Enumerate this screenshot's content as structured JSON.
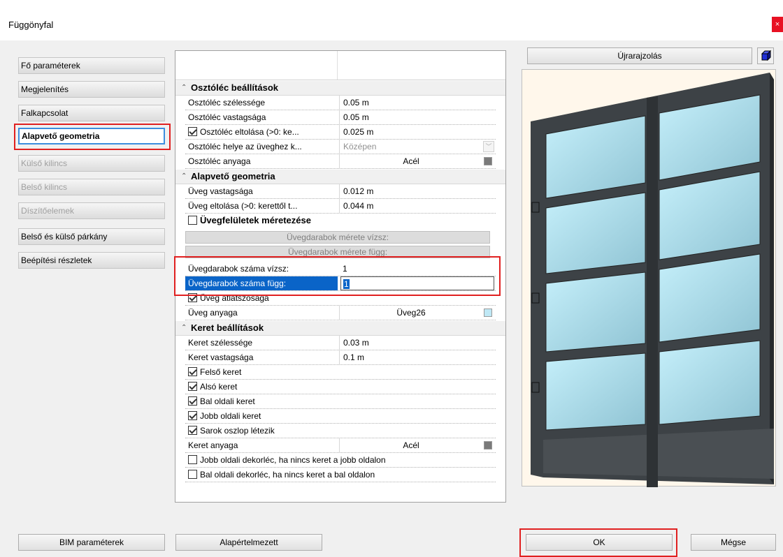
{
  "window": {
    "title": "Függönyfal",
    "close_glyph": "×"
  },
  "nav": {
    "items": [
      {
        "label": "Fő paraméterek",
        "state": "normal"
      },
      {
        "label": "Megjelenítés",
        "state": "normal"
      },
      {
        "label": "Falkapcsolat",
        "state": "normal"
      },
      {
        "label": "Alapvető geometria",
        "state": "active"
      },
      {
        "label": "Külső kilincs",
        "state": "disabled"
      },
      {
        "label": "Belső kilincs",
        "state": "disabled"
      },
      {
        "label": "Díszítőelemek",
        "state": "disabled"
      },
      {
        "label": "Belső és külső párkány",
        "state": "normal"
      },
      {
        "label": "Beépítési részletek",
        "state": "normal"
      }
    ]
  },
  "grid": {
    "osztolec": {
      "title": "Osztóléc beállítások",
      "rows": [
        {
          "label": "Osztóléc szélessége",
          "value": "0.05 m"
        },
        {
          "label": "Osztóléc vastagsága",
          "value": "0.05 m"
        },
        {
          "label": "Osztóléc eltolása (>0: ke...",
          "value": "0.025 m",
          "checked": true
        },
        {
          "label": "Osztóléc helye az üveghez k...",
          "value": "Középen"
        },
        {
          "label": "Osztóléc anyaga",
          "value": "Acél"
        }
      ]
    },
    "alapveto": {
      "title": "Alapvető geometria",
      "rows": [
        {
          "label": "Üveg vastagsága",
          "value": "0.012 m"
        },
        {
          "label": "Üveg eltolása (>0: kerettől t...",
          "value": "0.044 m"
        }
      ],
      "uvegfelulet_label": "Üvegfelületek méretezése",
      "uvegfelulet_checked": false,
      "size_h_button": "Üvegdarabok mérete vízsz:",
      "size_v_button": "Üvegdarabok mérete függ:",
      "count_h_label": "Üvegdarabok száma vízsz:",
      "count_h_value": "1",
      "count_v_label": "Üvegdarabok száma függ:",
      "count_v_value": "1",
      "atlatszosag_label": "Üveg átlátszósága",
      "atlatszosag_checked": true,
      "anyag_label": "Üveg anyaga",
      "anyag_value": "Üveg26"
    },
    "keret": {
      "title": "Keret beállítások",
      "szelesseg_label": "Keret szélessége",
      "szelesseg_value": "0.03 m",
      "vastagsag_label": "Keret vastagsága",
      "vastagsag_value": "0.1 m",
      "checks": [
        {
          "label": "Felső keret",
          "checked": true
        },
        {
          "label": "Alsó keret",
          "checked": true
        },
        {
          "label": "Bal oldali keret",
          "checked": true
        },
        {
          "label": "Jobb oldali keret",
          "checked": true
        },
        {
          "label": "Sarok oszlop létezik",
          "checked": true
        }
      ],
      "anyag_label": "Keret anyaga",
      "anyag_value": "Acél",
      "deco": [
        {
          "label": "Jobb oldali dekorléc, ha nincs keret a jobb oldalon",
          "checked": false
        },
        {
          "label": "Bal oldali dekorléc, ha nincs keret a bal oldalon",
          "checked": false
        }
      ]
    }
  },
  "preview": {
    "redraw_label": "Újrarajzolás",
    "cube_icon": "cube-icon"
  },
  "footer": {
    "bim_label": "BIM paraméterek",
    "default_label": "Alapértelmezett",
    "ok_label": "OK",
    "cancel_label": "Mégse"
  },
  "colors": {
    "highlight_red": "#e02020",
    "selection_blue": "#0a64c8",
    "steel_swatch": "#7a7a7a",
    "glass_swatch": "#bfe8f5"
  }
}
